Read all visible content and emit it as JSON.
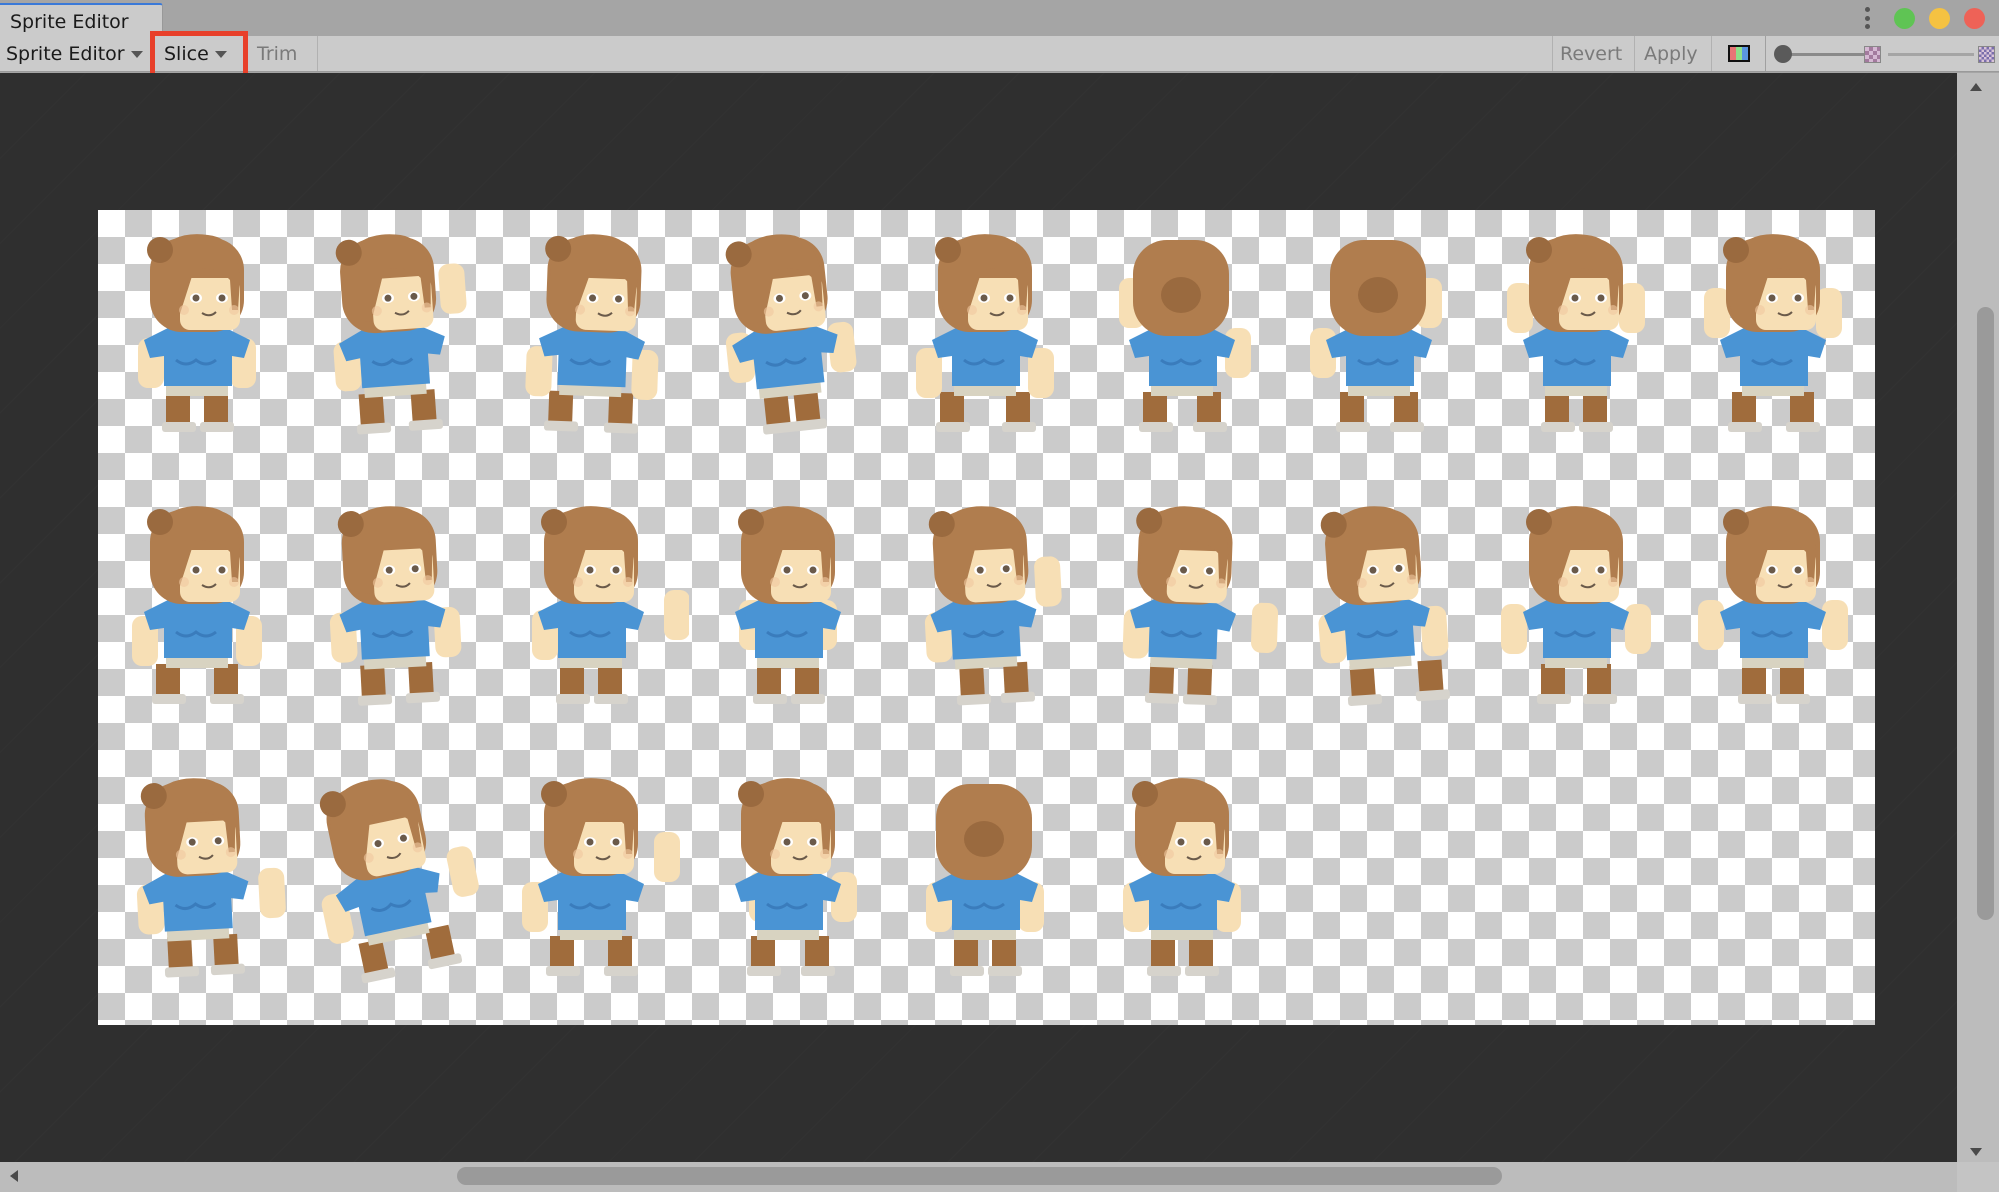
{
  "window": {
    "tab_title": "Sprite Editor",
    "controls": [
      {
        "name": "more-options-icon"
      },
      {
        "name": "maximize-button",
        "color": "#5fc454"
      },
      {
        "name": "minimize-button",
        "color": "#f5c242"
      },
      {
        "name": "close-button",
        "color": "#ee6257"
      }
    ]
  },
  "toolbar": {
    "mode_dropdown": "Sprite Editor",
    "slice_dropdown": "Slice",
    "trim_button": "Trim",
    "revert_button": "Revert",
    "apply_button": "Apply",
    "channel_toggle_icon": "rgb-channels-icon",
    "channel_colors": [
      "#e87676",
      "#8ee08a",
      "#5a96e0"
    ],
    "zoom_slider_value": 0,
    "mip_slider_value": 1,
    "highlighted_control": "Slice"
  },
  "canvas": {
    "background": "#2f2f2f",
    "sheet": {
      "columns": 9,
      "rows": 3,
      "sprite_count": 24,
      "row_counts": [
        9,
        9,
        6
      ],
      "palette": {
        "hair": "#b07d4e",
        "hair_dark": "#9a6a3f",
        "skin": "#f7dfb5",
        "skin_shade": "#e9c99a",
        "shirt": "#4a94d4",
        "shirt_dark": "#3a7cbc",
        "shorts": "#d8d3c1",
        "boots": "#a06c3c",
        "soles": "#d6d3cc",
        "eye": "#6a5a4a"
      },
      "sprites": [
        {
          "pose": "idle-front",
          "view": "front"
        },
        {
          "pose": "wave-right",
          "view": "front"
        },
        {
          "pose": "step",
          "view": "front"
        },
        {
          "pose": "crouch",
          "view": "front"
        },
        {
          "pose": "jump",
          "view": "front"
        },
        {
          "pose": "back-climb-left",
          "view": "back"
        },
        {
          "pose": "back-climb-right",
          "view": "back"
        },
        {
          "pose": "cheer",
          "view": "front"
        },
        {
          "pose": "cheer-jump",
          "view": "front"
        },
        {
          "pose": "walk-1",
          "view": "front"
        },
        {
          "pose": "walk-2",
          "view": "front"
        },
        {
          "pose": "punch",
          "view": "front"
        },
        {
          "pose": "hold",
          "view": "front"
        },
        {
          "pose": "wave-up",
          "view": "front"
        },
        {
          "pose": "point",
          "view": "front"
        },
        {
          "pose": "kick",
          "view": "front"
        },
        {
          "pose": "arms-out",
          "view": "front"
        },
        {
          "pose": "arms-out-2",
          "view": "front"
        },
        {
          "pose": "reach",
          "view": "front"
        },
        {
          "pose": "fall",
          "view": "front"
        },
        {
          "pose": "leap",
          "view": "front"
        },
        {
          "pose": "hug",
          "view": "front"
        },
        {
          "pose": "back-idle",
          "view": "back"
        },
        {
          "pose": "idle-front-2",
          "view": "front"
        }
      ]
    }
  },
  "scrollbars": {
    "vertical": {
      "position": 0.22,
      "visible_fraction": 0.6
    },
    "horizontal": {
      "position": 0.23,
      "visible_fraction": 0.55
    }
  }
}
